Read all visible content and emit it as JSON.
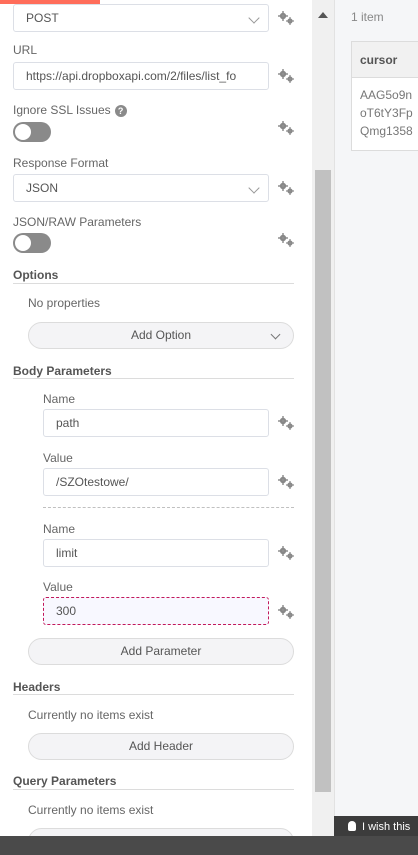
{
  "request": {
    "method": "POST",
    "url_label": "URL",
    "url_value": "https://api.dropboxapi.com/2/files/list_fo",
    "ignore_ssl_label": "Ignore SSL Issues",
    "ignore_ssl": false,
    "response_format_label": "Response Format",
    "response_format": "JSON",
    "json_raw_label": "JSON/RAW Parameters",
    "json_raw": false
  },
  "options": {
    "title": "Options",
    "empty_text": "No properties",
    "add_button": "Add Option"
  },
  "body_parameters": {
    "title": "Body Parameters",
    "name_label": "Name",
    "value_label": "Value",
    "items": [
      {
        "name": "path",
        "value": "/SZOtestowe/"
      },
      {
        "name": "limit",
        "value": "300"
      }
    ],
    "add_button": "Add Parameter"
  },
  "headers": {
    "title": "Headers",
    "empty_text": "Currently no items exist",
    "add_button": "Add Header"
  },
  "query_parameters": {
    "title": "Query Parameters",
    "empty_text": "Currently no items exist"
  },
  "output": {
    "item_count": "1 item",
    "column": "cursor",
    "cell_lines": [
      "AAG5o9n",
      "oT6tY3Fp",
      "Qmg1358"
    ]
  },
  "feedback": {
    "label": "I wish this"
  },
  "icons": {
    "gear": "gear-icon",
    "help": "question-icon",
    "chevron": "chevron-down-icon",
    "bulb": "lightbulb-icon"
  },
  "colors": {
    "accent": "#ff6d5a",
    "focus_border": "#c2185b",
    "toggle_off": "#8a8a8a"
  }
}
